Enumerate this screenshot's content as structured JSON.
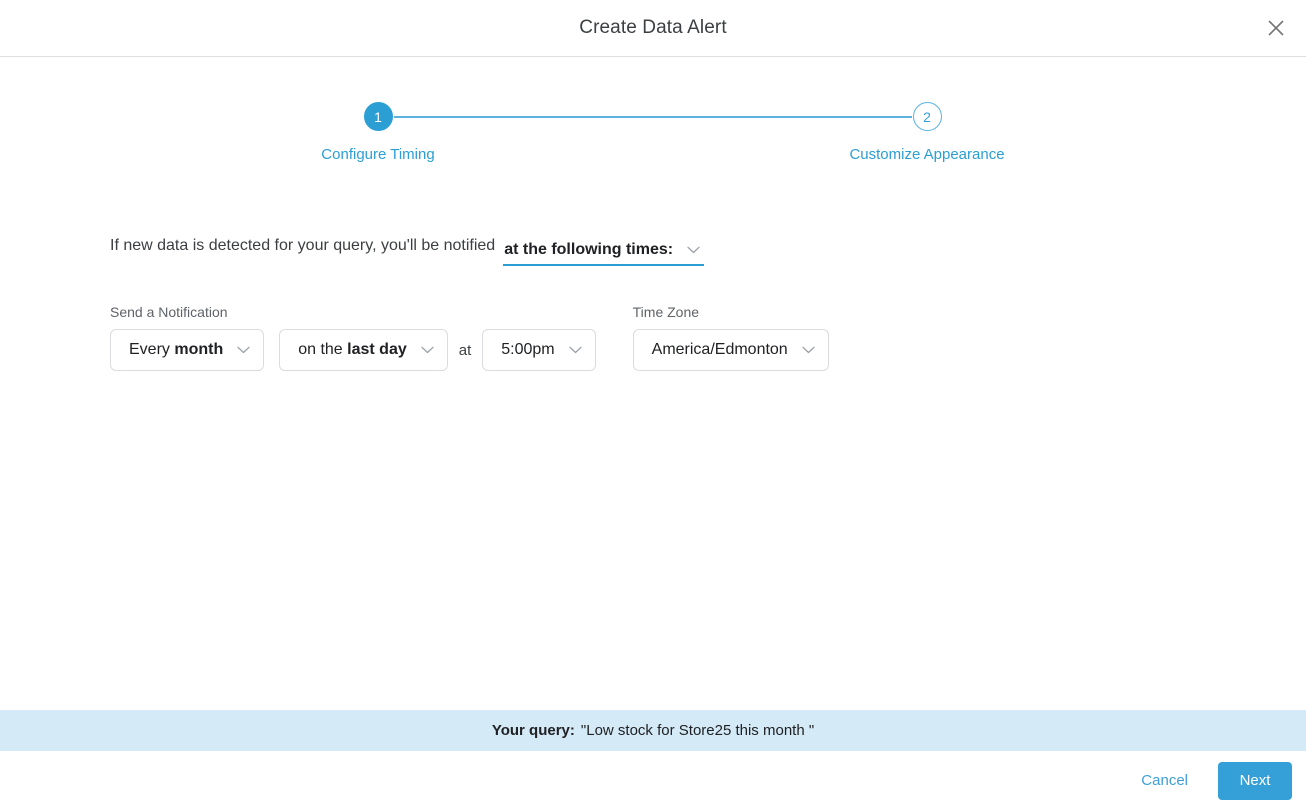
{
  "header": {
    "title": "Create Data Alert",
    "close_icon": "close-icon"
  },
  "stepper": {
    "steps": [
      {
        "number": "1",
        "label": "Configure Timing",
        "state": "active"
      },
      {
        "number": "2",
        "label": "Customize Appearance",
        "state": "inactive"
      }
    ]
  },
  "sentence": {
    "prefix": "If new data is detected for your query, you'll be notified",
    "trigger_select": {
      "value": "at the following times:",
      "chevron_icon": "chevron-down-icon"
    }
  },
  "schedule": {
    "notification_label": "Send a Notification",
    "frequency_select": {
      "prefix": "Every ",
      "value": "month",
      "chevron_icon": "chevron-down-icon"
    },
    "day_select": {
      "prefix": "on the ",
      "value": "last day",
      "chevron_icon": "chevron-down-icon"
    },
    "at_text": "at",
    "time_select": {
      "value": "5:00pm",
      "chevron_icon": "chevron-down-icon"
    },
    "timezone_label": "Time Zone",
    "timezone_select": {
      "value": "America/Edmonton",
      "chevron_icon": "chevron-down-icon"
    }
  },
  "query_banner": {
    "label": "Your query:",
    "text": "\"Low stock for Store25 this month \""
  },
  "footer": {
    "cancel_label": "Cancel",
    "next_label": "Next"
  },
  "colors": {
    "accent": "#2b9fd4",
    "accent_button": "#35a0d7",
    "banner_bg": "#d4eaf7",
    "border": "#dadce0",
    "text": "#3c4043",
    "muted_text": "#5f6368"
  }
}
